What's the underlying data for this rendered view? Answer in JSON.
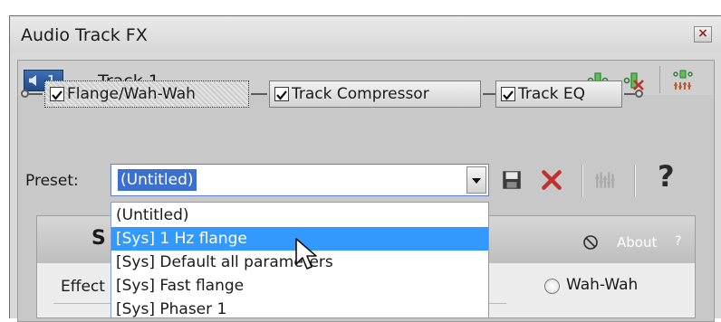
{
  "window": {
    "title": "Audio Track FX",
    "close_glyph": "×"
  },
  "track": {
    "number": "1",
    "name": "Track 1",
    "icons": [
      "insert-plugin-icon",
      "remove-plugin-icon",
      "plugin-chain-icon"
    ]
  },
  "fx_chain": [
    {
      "label": "Flange/Wah-Wah",
      "checked": true,
      "active": true
    },
    {
      "label": "Track Compressor",
      "checked": true,
      "active": false
    },
    {
      "label": "Track EQ",
      "checked": true,
      "active": false
    }
  ],
  "preset": {
    "label": "Preset:",
    "value": "(Untitled)",
    "tools": [
      "save-icon",
      "delete-icon",
      "chain-icon",
      "help-icon"
    ],
    "help_glyph": "?",
    "options": [
      "(Untitled)",
      "[Sys] 1 Hz flange",
      "[Sys] Default all parameters",
      "[Sys] Fast flange",
      "[Sys] Phaser 1"
    ],
    "highlighted_option": "[Sys] 1 Hz flange"
  },
  "plugin": {
    "brand_visible_text": "S",
    "about_label": "About",
    "about_help": "?",
    "effect_label": "Effect",
    "radio_wah_label": "Wah-Wah"
  },
  "colors": {
    "selection": "#3b6fd0",
    "dropdown_highlight": "#3399ff",
    "track_badge": "#2d5ea3",
    "delete_red": "#c0302f"
  }
}
